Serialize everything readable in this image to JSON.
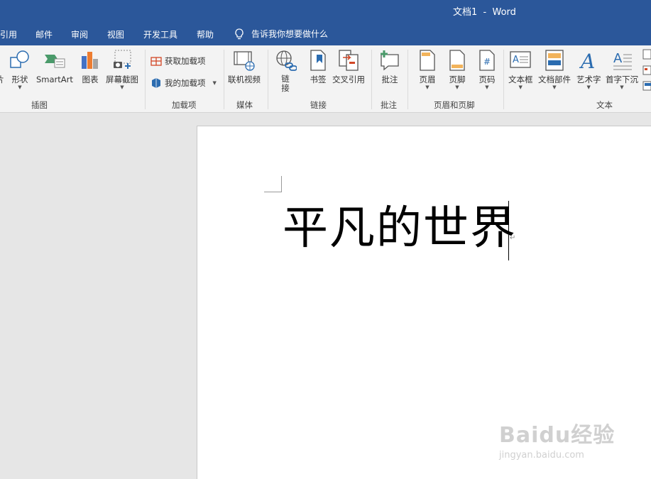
{
  "window": {
    "title": "文档1  -  Word"
  },
  "menu": {
    "items": [
      "引用",
      "邮件",
      "审阅",
      "视图",
      "开发工具",
      "帮助"
    ],
    "tell_me": "告诉我你想要做什么"
  },
  "ribbon": {
    "illustrations": {
      "partial_label": "片",
      "shapes": "形状",
      "smartart": "SmartArt",
      "chart": "图表",
      "screenshot": "屏幕截图",
      "group": "插图"
    },
    "addins": {
      "get": "获取加载项",
      "my": "我的加载项",
      "group": "加载项"
    },
    "media": {
      "online_video": "联机视频",
      "group": "媒体"
    },
    "links": {
      "link_line1": "链",
      "link_line2": "接",
      "bookmark": "书签",
      "cross_ref": "交叉引用",
      "group": "链接"
    },
    "comments": {
      "comment": "批注",
      "group": "批注"
    },
    "header_footer": {
      "header": "页眉",
      "footer": "页脚",
      "page_number": "页码",
      "group": "页眉和页脚"
    },
    "text": {
      "textbox": "文本框",
      "quick_parts": "文档部件",
      "wordart": "艺术字",
      "dropcap": "首字下沉",
      "group": "文本"
    }
  },
  "document": {
    "content": "平凡的世界"
  },
  "watermark": {
    "logo": "Baidu经验",
    "url": "jingyan.baidu.com"
  },
  "colors": {
    "title_blue": "#2b579a",
    "ribbon_bg": "#f3f3f3"
  }
}
